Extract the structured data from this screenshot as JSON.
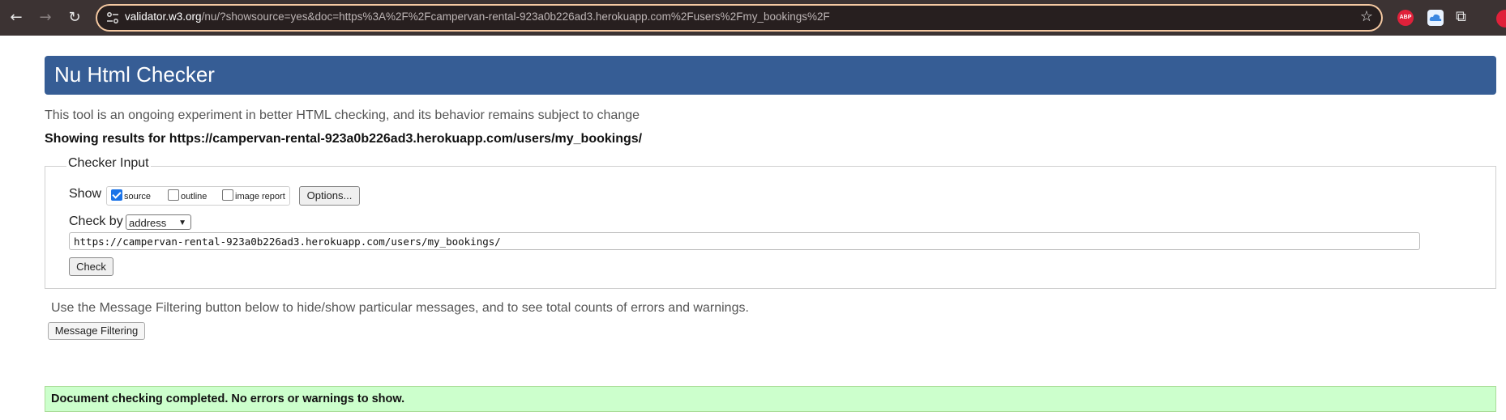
{
  "browser": {
    "url_host": "validator.w3.org",
    "url_rest": "/nu/?showsource=yes&doc=https%3A%2F%2Fcampervan-rental-923a0b226ad3.herokuapp.com%2Fusers%2Fmy_bookings%2F",
    "icons": [
      "back-icon",
      "forward-icon",
      "reload-icon",
      "site-settings-icon",
      "star-icon",
      "adblock-icon",
      "cloud-icon",
      "extensions-icon",
      "profile-icon"
    ],
    "abp_label": "ABP"
  },
  "page": {
    "title": "Nu Html Checker",
    "intro": "This tool is an ongoing experiment in better HTML checking, and its behavior remains subject to change",
    "results_line": "Showing results for https://campervan-rental-923a0b226ad3.herokuapp.com/users/my_bookings/"
  },
  "checker": {
    "legend": "Checker Input",
    "show_label": "Show",
    "options": [
      {
        "label": "source",
        "checked": true
      },
      {
        "label": "outline",
        "checked": false
      },
      {
        "label": "image report",
        "checked": false
      }
    ],
    "options_button": "Options...",
    "check_by_label": "Check by",
    "check_by_value": "address",
    "address_value": "https://campervan-rental-923a0b226ad3.herokuapp.com/users/my_bookings/",
    "check_button": "Check"
  },
  "filtering": {
    "note": "Use the Message Filtering button below to hide/show particular messages, and to see total counts of errors and warnings.",
    "button": "Message Filtering"
  },
  "result": {
    "message": "Document checking completed. No errors or warnings to show."
  },
  "colors": {
    "header": "#365d95",
    "success_bg": "#ccffcc",
    "toolbar_bg": "#3c3333"
  }
}
